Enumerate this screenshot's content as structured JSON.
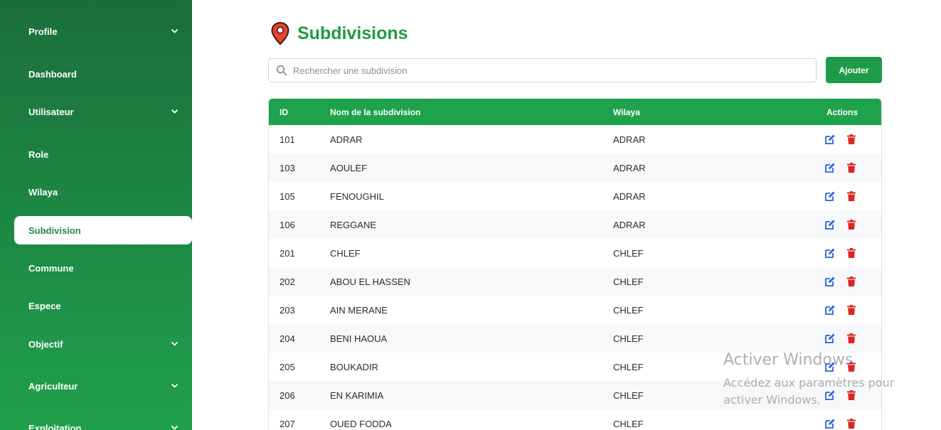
{
  "sidebar": {
    "items": [
      {
        "label": "Profile",
        "dropdown": true,
        "active": false
      },
      {
        "label": "Dashboard",
        "dropdown": false,
        "active": false
      },
      {
        "label": "Utilisateur",
        "dropdown": true,
        "active": false
      },
      {
        "label": "Role",
        "dropdown": false,
        "active": false
      },
      {
        "label": "Wilaya",
        "dropdown": false,
        "active": false
      },
      {
        "label": "Subdivision",
        "dropdown": false,
        "active": true
      },
      {
        "label": "Commune",
        "dropdown": false,
        "active": false
      },
      {
        "label": "Espece",
        "dropdown": false,
        "active": false
      },
      {
        "label": "Objectif",
        "dropdown": true,
        "active": false
      },
      {
        "label": "Agriculteur",
        "dropdown": true,
        "active": false
      },
      {
        "label": "Exploitation",
        "dropdown": true,
        "active": false
      }
    ]
  },
  "header": {
    "title": "Subdivisions",
    "icon": "map-pin-icon"
  },
  "search": {
    "placeholder": "Rechercher une subdivision",
    "value": ""
  },
  "add_button": {
    "label": "Ajouter"
  },
  "table": {
    "columns": [
      "ID",
      "Nom de la subdivision",
      "Wilaya",
      "Actions"
    ],
    "rows": [
      {
        "id": "101",
        "name": "ADRAR",
        "wilaya": "ADRAR"
      },
      {
        "id": "103",
        "name": "AOULEF",
        "wilaya": "ADRAR"
      },
      {
        "id": "105",
        "name": "FENOUGHIL",
        "wilaya": "ADRAR"
      },
      {
        "id": "106",
        "name": "REGGANE",
        "wilaya": "ADRAR"
      },
      {
        "id": "201",
        "name": "CHLEF",
        "wilaya": "CHLEF"
      },
      {
        "id": "202",
        "name": "ABOU EL HASSEN",
        "wilaya": "CHLEF"
      },
      {
        "id": "203",
        "name": "AIN MERANE",
        "wilaya": "CHLEF"
      },
      {
        "id": "204",
        "name": "BENI HAOUA",
        "wilaya": "CHLEF"
      },
      {
        "id": "205",
        "name": "BOUKADIR",
        "wilaya": "CHLEF"
      },
      {
        "id": "206",
        "name": "EN KARIMIA",
        "wilaya": "CHLEF"
      },
      {
        "id": "207",
        "name": "OUED FODDA",
        "wilaya": "CHLEF"
      }
    ]
  },
  "watermark": {
    "line1": "Activer Windows",
    "line2": "Accédez aux paramètres pour activer Windows."
  },
  "colors": {
    "brand_green": "#1e9b48",
    "title_green": "#1f9a47",
    "edit_blue": "#2563d9",
    "delete_red": "#d92525"
  }
}
